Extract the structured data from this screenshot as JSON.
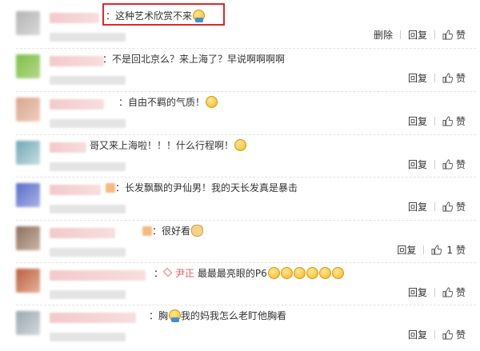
{
  "comments": [
    {
      "text": "：这种艺术欣赏不来",
      "emojis": [
        "blue"
      ],
      "actions": [
        "删除",
        "回复",
        "赞"
      ],
      "highlighted": true,
      "avatar_colors": [
        "#b4b4b4",
        "#d9d9d9"
      ]
    },
    {
      "text": "：不是回北京么？来上海了？早说啊啊啊啊",
      "emojis": [],
      "actions": [
        "回复",
        "赞"
      ],
      "avatar_colors": [
        "#7fbe4a",
        "#b4d98a"
      ]
    },
    {
      "text": "：自由不羁的气质！",
      "emojis": [
        "yellow"
      ],
      "actions": [
        "回复",
        "赞"
      ],
      "avatar_colors": [
        "#d8a58d",
        "#f0cfc0"
      ]
    },
    {
      "text": "哥又来上海啦！！！什么行程啊！",
      "emojis": [
        "yellow"
      ],
      "actions": [
        "回复",
        "赞"
      ],
      "avatar_colors": [
        "#6fa9b8",
        "#c9dde0"
      ]
    },
    {
      "text": "：长发飘飘的尹仙男！我的天长发真是暴击",
      "emojis": [],
      "actions": [
        "回复",
        "赞"
      ],
      "avatar_colors": [
        "#5a6cc8",
        "#a8b3e6"
      ]
    },
    {
      "text": "：很好看",
      "emojis": [
        "cat"
      ],
      "actions": [
        "回复",
        "1",
        "赞"
      ],
      "avatar_colors": [
        "#8b6f5e",
        "#cbb5a5"
      ]
    },
    {
      "prefix": "：",
      "vip": "尹正",
      "text": " 最最最亮眼的P6",
      "emojis": [
        "yellow",
        "yellow",
        "yellow",
        "yellow",
        "yellow",
        "yellow"
      ],
      "actions": [
        "回复",
        "赞"
      ],
      "avatar_colors": [
        "#b9603d",
        "#e6b199"
      ]
    },
    {
      "prefix": "：胸",
      "text": "我的妈我怎么老盯他胸看",
      "emojis_inline": [
        "blue"
      ],
      "actions": [
        "回复",
        "赞"
      ],
      "avatar_colors": [
        "#9aa7b0",
        "#d4d9dc"
      ]
    }
  ]
}
